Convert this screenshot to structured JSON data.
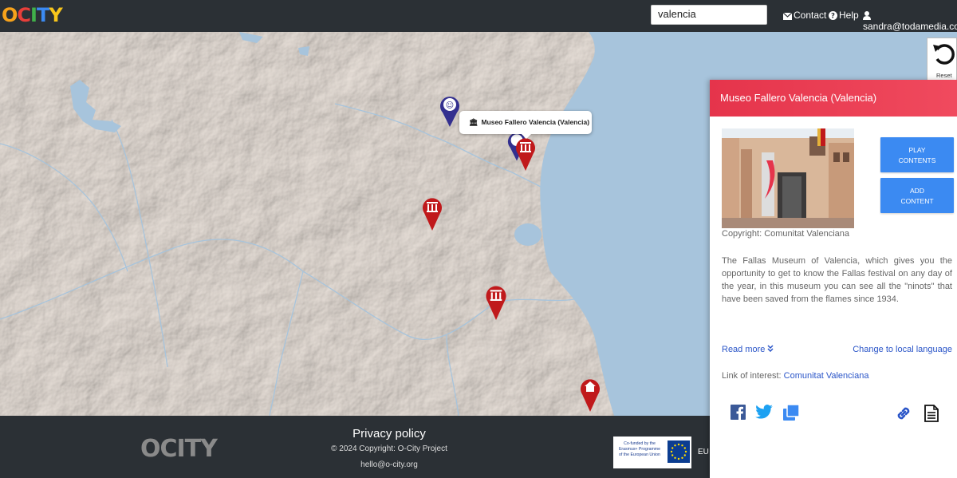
{
  "header": {
    "logo_text": "OCITY",
    "search_value": "valencia",
    "contact_label": "Contact",
    "help_label": "Help",
    "user_label": "sandra@todamedia.com"
  },
  "map": {
    "tooltip": "Museo Fallero Valencia (Valencia)",
    "reset_label": "Reset"
  },
  "panel": {
    "title": "Museo Fallero Valencia (Valencia)",
    "photo_caption": "Copyright: Comunitat Valenciana",
    "play_button_line1": "PLAY",
    "play_button_line2": "CONTENTS",
    "add_button_line1": "ADD",
    "add_button_line2": "CONTENT",
    "description": "The Fallas Museum of Valencia, which gives you the opportunity to get to know the Fallas festival on any day of the year, in this museum you can see all the \"ninots\" that have been saved from the flames since 1934.",
    "read_more": "Read more",
    "change_language": "Change to local language",
    "link_of_interest_label": "Link of interest:",
    "link_of_interest_value": "Comunitat Valenciana"
  },
  "footer": {
    "logo_text": "OCITY",
    "privacy": "Privacy policy",
    "copyright": "© 2024 Copyright: O-City Project",
    "email": "hello@o-city.org",
    "eu_text_1": "Co-funded by the",
    "eu_text_2": "Erasmus+ Programme",
    "eu_text_3": "of the European Union",
    "eu_label": "EU"
  },
  "colors": {
    "topbar": "#2b3035",
    "panel_header": "#e5344b",
    "button": "#3b8af2",
    "link": "#2a55c8",
    "marker_red": "#c0191b",
    "marker_blue": "#332f8f",
    "sea": "#a7c4dc",
    "land": "#e6ddd6"
  }
}
